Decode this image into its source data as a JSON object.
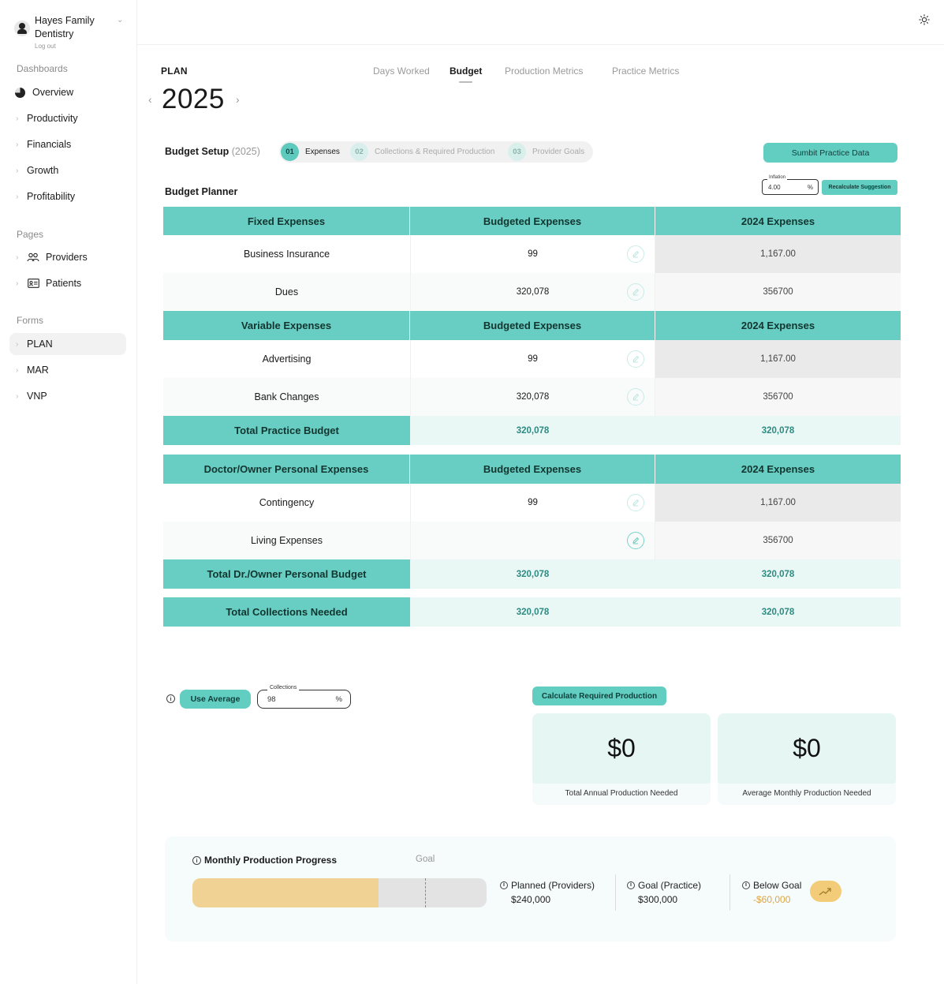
{
  "org": {
    "name": "Hayes Family Dentistry",
    "logout": "Log out"
  },
  "sidebar": {
    "dashboards_title": "Dashboards",
    "dashboards": [
      {
        "label": "Overview"
      },
      {
        "label": "Productivity"
      },
      {
        "label": "Financials"
      },
      {
        "label": "Growth"
      },
      {
        "label": "Profitability"
      }
    ],
    "pages_title": "Pages",
    "pages": [
      {
        "label": "Providers",
        "icon": "people-icon"
      },
      {
        "label": "Patients",
        "icon": "id-card-icon"
      }
    ],
    "forms_title": "Forms",
    "forms": [
      {
        "label": "PLAN",
        "active": true
      },
      {
        "label": "MAR"
      },
      {
        "label": "VNP"
      }
    ]
  },
  "header": {
    "plan_label": "PLAN",
    "year": "2025",
    "tabs": [
      {
        "label": "Days Worked"
      },
      {
        "label": "Budget",
        "active": true
      },
      {
        "label": "Production Metrics"
      },
      {
        "label": "Practice Metrics"
      }
    ]
  },
  "budget_setup": {
    "title": "Budget Setup",
    "year": "(2025)",
    "steps": [
      {
        "num": "01",
        "label": "Expenses",
        "active": true
      },
      {
        "num": "02",
        "label": "Collections & Required Production"
      },
      {
        "num": "03",
        "label": "Provider Goals"
      }
    ],
    "submit_label": "Sumbit Practice Data"
  },
  "planner": {
    "title": "Budget Planner",
    "inflation_label": "Inflation",
    "inflation_value": "4.00",
    "inflation_unit": "%",
    "recalc_label": "Recalculate Suggestion",
    "sections": [
      {
        "header": [
          "Fixed Expenses",
          "Budgeted Expenses",
          "2024 Expenses"
        ],
        "rows": [
          {
            "name": "Business Insurance",
            "budget": "99",
            "prior": "1,167.00"
          },
          {
            "name": "Dues",
            "budget": "320,078",
            "prior": "356700"
          }
        ]
      },
      {
        "header": [
          "Variable Expenses",
          "Budgeted Expenses",
          "2024 Expenses"
        ],
        "rows": [
          {
            "name": "Advertising",
            "budget": "99",
            "prior": "1,167.00"
          },
          {
            "name": "Bank Changes",
            "budget": "320,078",
            "prior": "356700"
          }
        ],
        "total": {
          "label": "Total Practice Budget",
          "budget": "320,078",
          "prior": "320,078"
        }
      },
      {
        "header": [
          "Doctor/Owner Personal Expenses",
          "Budgeted Expenses",
          "2024 Expenses"
        ],
        "rows": [
          {
            "name": "Contingency",
            "budget": "99",
            "prior": "1,167.00"
          },
          {
            "name": "Living Expenses",
            "budget": "",
            "prior": "356700"
          }
        ],
        "total": {
          "label": "Total Dr./Owner Personal Budget",
          "budget": "320,078",
          "prior": "320,078"
        }
      }
    ],
    "grand_total": {
      "label": "Total Collections Needed",
      "budget": "320,078",
      "prior": "320,078"
    }
  },
  "collections": {
    "use_average_label": "Use Average",
    "field_label": "Collections",
    "field_value": "98",
    "field_unit": "%"
  },
  "production": {
    "calc_label": "Calculate Required Production",
    "annual_value": "$0",
    "annual_label": "Total Annual Production Needed",
    "monthly_value": "$0",
    "monthly_label": "Average Monthly Production Needed"
  },
  "progress": {
    "title": "Monthly Production Progress",
    "goal_label": "Goal",
    "planned_fraction": 0.8,
    "goal_fraction": 1.0,
    "planned_label": "Planned (Providers)",
    "planned_value": "$240,000",
    "goal_practice_label": "Goal (Practice)",
    "goal_practice_value": "$300,000",
    "below_label": "Below Goal",
    "below_value": "-$60,000"
  },
  "colors": {
    "accent": "#68cec3",
    "accent_light": "#e9f7f5",
    "progress_fill": "#f0d394",
    "negative": "#d9a64a"
  }
}
